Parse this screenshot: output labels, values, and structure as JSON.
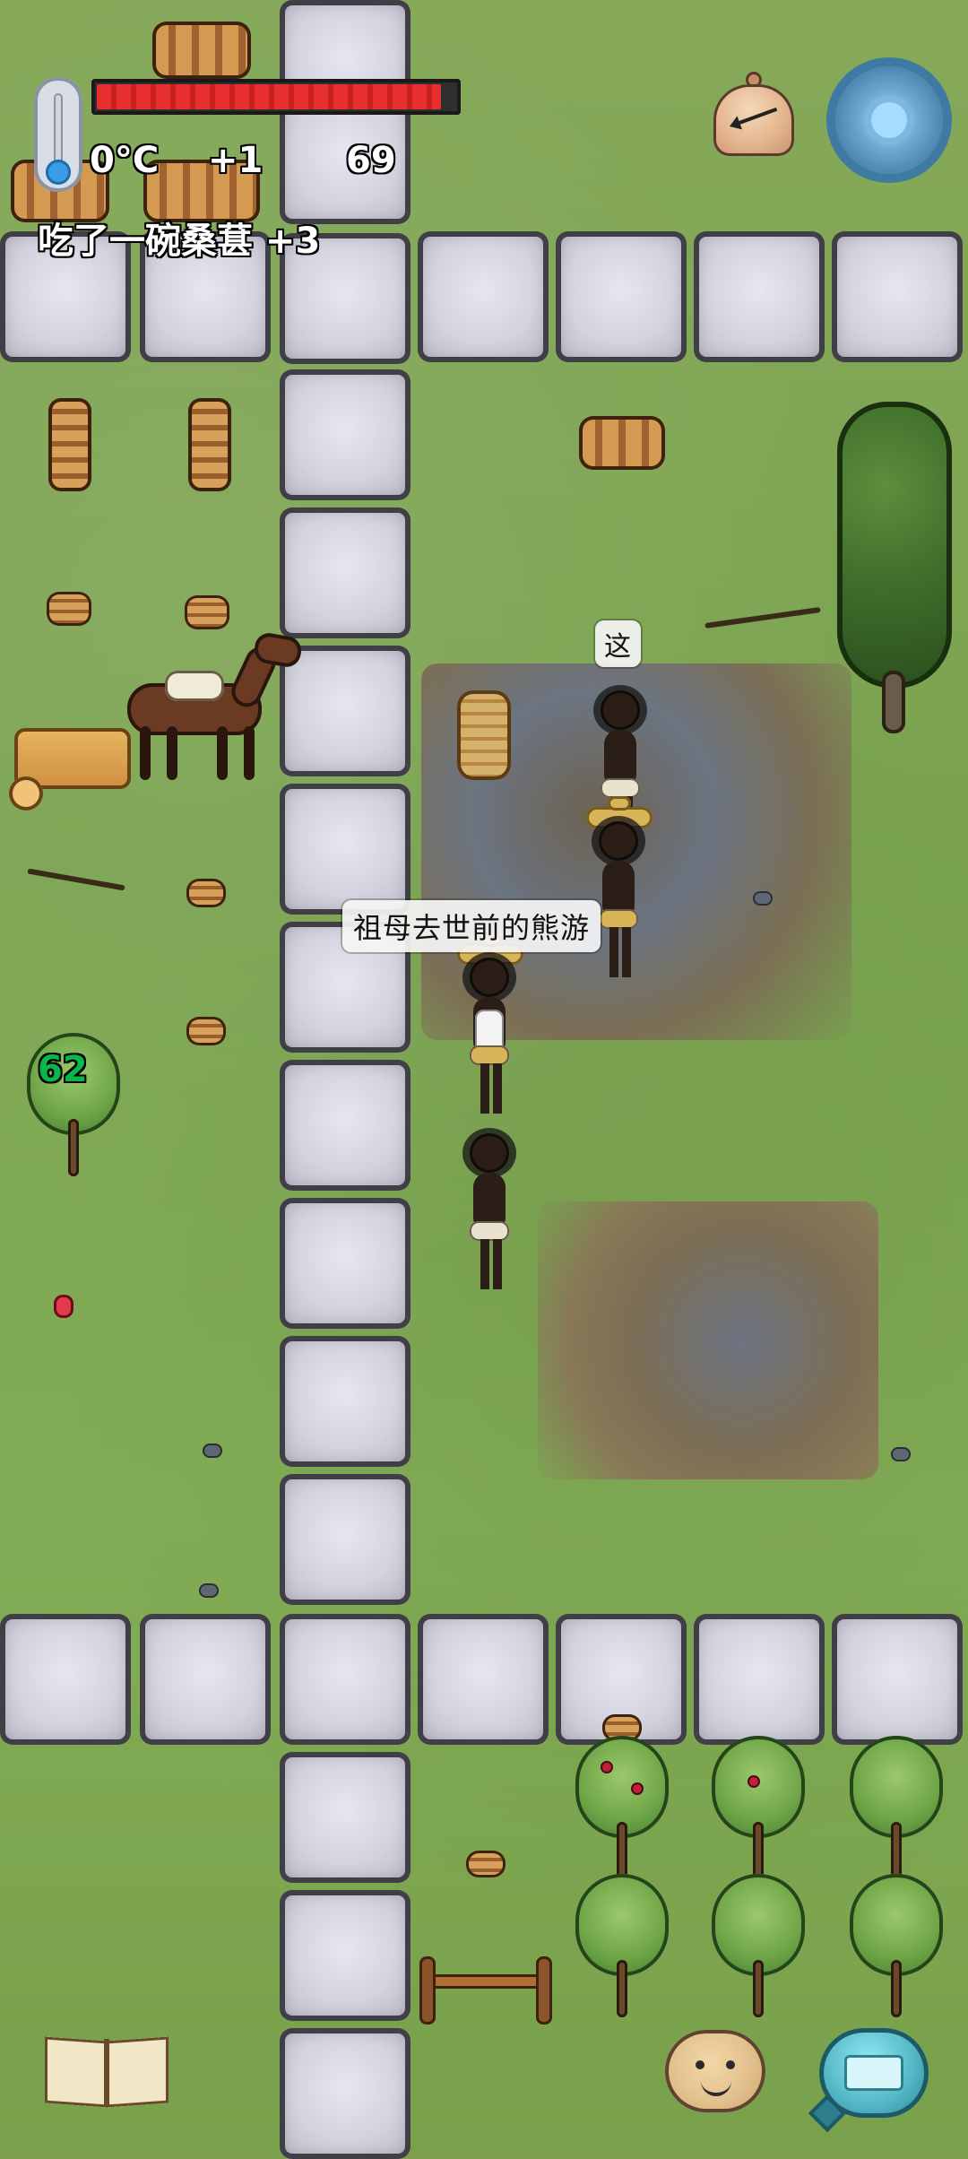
{
  "hud": {
    "temperature": "0°C",
    "temp_delta": "+1",
    "age": "69",
    "food_fraction": 0.96,
    "status_message": "吃了一碗桑葚 +3"
  },
  "world": {
    "speech_top": "这",
    "speech_main": "祖母去世前的熊游",
    "plant_number": "62"
  },
  "colors": {
    "grass": "#7aa34f",
    "food_red": "#e82f2f",
    "stone": "#d3d3df",
    "path_outline": "#3f3f45",
    "green_number": "#00aa22"
  },
  "icons": {
    "thermometer": "thermometer-icon",
    "settings": "gear-icon",
    "time": "bell-compass-icon",
    "recipe_book": "book-icon",
    "keyboard": "keyboard-icon",
    "emote": "emote-icon"
  }
}
